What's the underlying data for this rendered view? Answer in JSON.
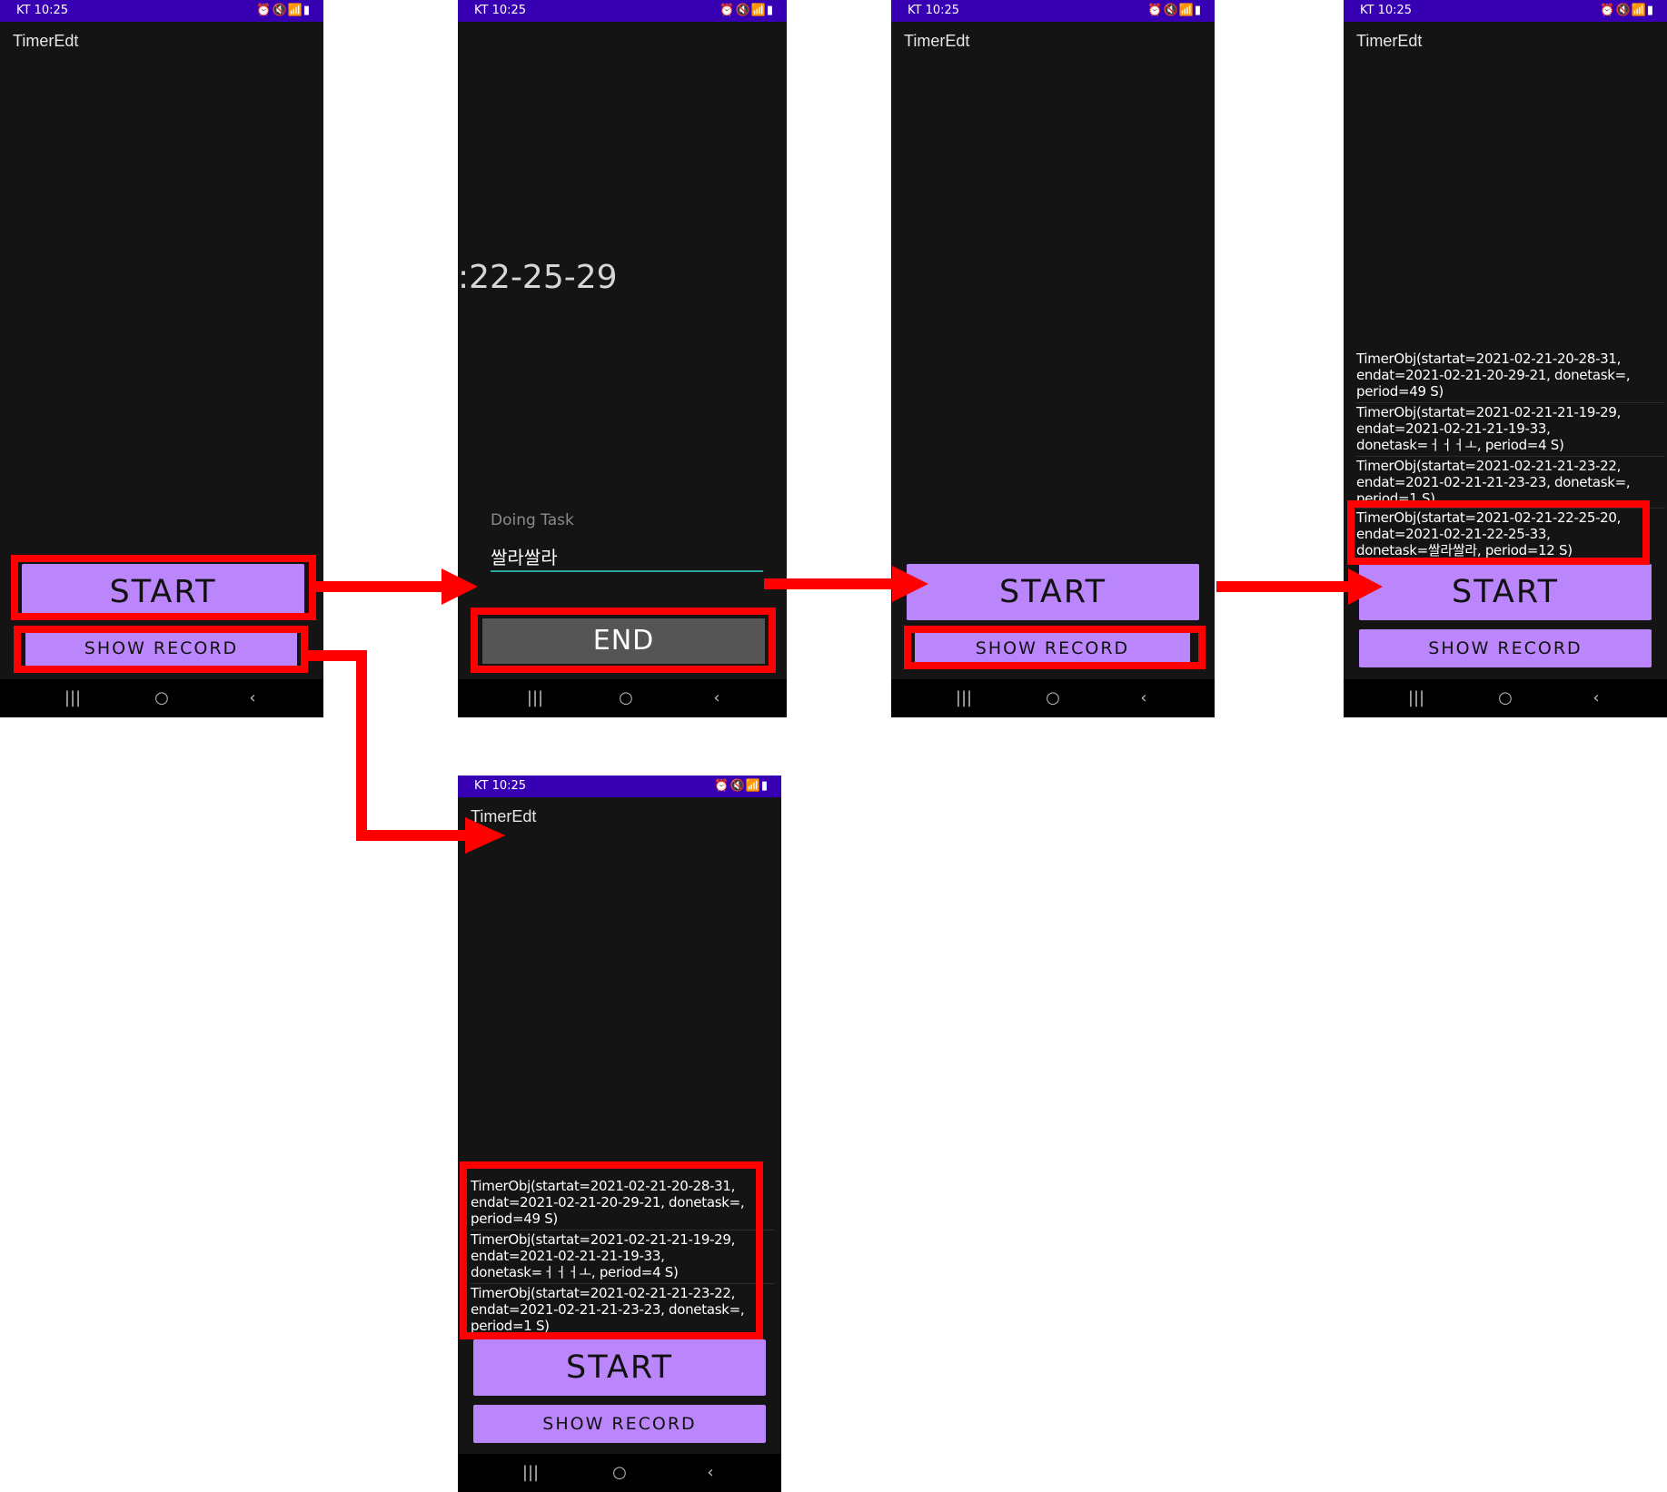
{
  "status": {
    "carrier_time": "KT 10:25",
    "icons": "⏰🔇📶▮"
  },
  "app": {
    "title": "TimerEdt"
  },
  "buttons": {
    "start": "START",
    "show_record": "SHOW RECORD",
    "end": "END"
  },
  "nav": {
    "recents": "|||",
    "home": "○",
    "back": "‹"
  },
  "timer": {
    "display": ":22-25-29"
  },
  "task": {
    "hint": "Doing Task",
    "value": "쌀라쌀라"
  },
  "records": [
    {
      "lines": [
        "TimerObj(startat=2021-02-21-20-28-31,",
        "endat=2021-02-21-20-29-21, donetask=,",
        "period=49 S)"
      ]
    },
    {
      "lines": [
        "TimerObj(startat=2021-02-21-21-19-29,",
        "endat=2021-02-21-21-19-33,",
        "donetask=ㅓㅓㅓㅗ, period=4 S)"
      ]
    },
    {
      "lines": [
        "TimerObj(startat=2021-02-21-21-23-22,",
        "endat=2021-02-21-21-23-23, donetask=,",
        "period=1 S)"
      ]
    },
    {
      "lines": [
        "TimerObj(startat=2021-02-21-22-25-20,",
        "endat=2021-02-21-22-25-33,",
        "donetask=쌀라쌀라, period=12 S)"
      ]
    }
  ],
  "colors": {
    "status_bar": "#3700b3",
    "background": "#141414",
    "button": "#bb86fc",
    "end_button": "#555555",
    "highlight": "#ff0000",
    "underline": "#26a69a"
  }
}
